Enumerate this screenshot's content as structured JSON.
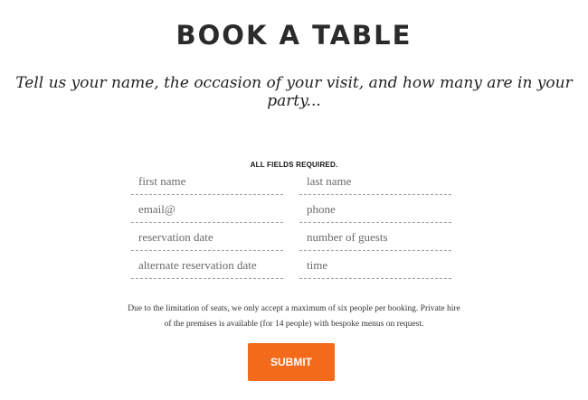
{
  "header": {
    "title": "BOOK A TABLE",
    "subtitle": "Tell us your name, the occasion of your visit, and how many are in your party..."
  },
  "form": {
    "required_note": "ALL FIELDS REQUIRED.",
    "fields": {
      "first_name": {
        "placeholder": "first name",
        "value": ""
      },
      "last_name": {
        "placeholder": "last name",
        "value": ""
      },
      "email": {
        "placeholder": "email@",
        "value": ""
      },
      "phone": {
        "placeholder": "phone",
        "value": ""
      },
      "reservation_date": {
        "placeholder": "reservation date",
        "value": ""
      },
      "number_of_guests": {
        "placeholder": "number of guests",
        "value": ""
      },
      "alternate_reservation_date": {
        "placeholder": "alternate reservation date",
        "value": ""
      },
      "time": {
        "placeholder": "time",
        "value": ""
      }
    },
    "notice": "Due to the limitation of seats, we only accept a maximum of six people per booking. Private hire of the premises is available (for 14 people) with bespoke menus on request.",
    "submit_label": "SUBMIT"
  },
  "colors": {
    "submit_background": "#f46a1b",
    "submit_text": "#ffffff",
    "title_text": "#2b2b2b"
  }
}
